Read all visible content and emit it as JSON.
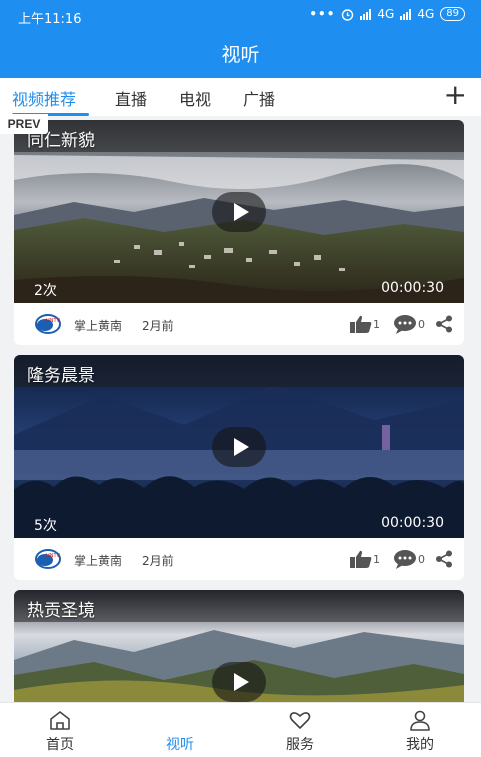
{
  "status": {
    "time": "上午11:16",
    "network1": "4G",
    "network2": "4G",
    "battery": "89"
  },
  "header": {
    "title": "视听"
  },
  "tabs": [
    {
      "label": "视频推荐",
      "active": true
    },
    {
      "label": "直播"
    },
    {
      "label": "电视"
    },
    {
      "label": "广播"
    }
  ],
  "prev_label": "PREV",
  "videos": [
    {
      "title": "同仁新貌",
      "views": "2次",
      "duration": "00:00:30",
      "source": "掌上黄南",
      "time_ago": "2月前",
      "likes": "1",
      "comments": "0"
    },
    {
      "title": "隆务晨景",
      "views": "5次",
      "duration": "00:00:30",
      "source": "掌上黄南",
      "time_ago": "2月前",
      "likes": "1",
      "comments": "0"
    },
    {
      "title": "热贡圣境"
    }
  ],
  "bottom_nav": [
    {
      "label": "首页",
      "icon": "home-icon"
    },
    {
      "label": "视听",
      "icon": "none",
      "active": true
    },
    {
      "label": "服务",
      "icon": "heart-icon"
    },
    {
      "label": "我的",
      "icon": "user-icon"
    }
  ],
  "colors": {
    "accent": "#1e8ff0"
  }
}
